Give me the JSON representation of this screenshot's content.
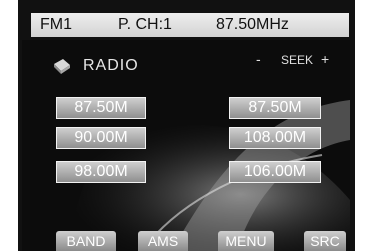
{
  "status_bar": {
    "band": "FM1",
    "preset_channel": "P. CH:1",
    "frequency": "87.50MHz"
  },
  "title": {
    "label": "RADIO",
    "icon": "radio-icon"
  },
  "seek": {
    "minus": "-",
    "label": "SEEK",
    "plus": "+"
  },
  "presets": [
    "87.50M",
    "90.00M",
    "98.00M",
    "87.50M",
    "108.00M",
    "106.00M"
  ],
  "bottom_buttons": {
    "band": "BAND",
    "ams": "AMS",
    "menu": "MENU",
    "src": "SRC"
  },
  "colors": {
    "bezel": "#111111",
    "preset_fill": "#b0b0b0",
    "status_bar": "#e0e0e0"
  }
}
